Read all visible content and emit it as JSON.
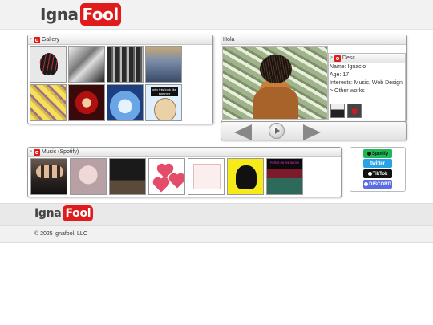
{
  "header": {
    "logo_part1": "Igna",
    "logo_part2": "Fool"
  },
  "gallery": {
    "title": "Gallery",
    "thumb_captions": {
      "t8": "why this look like summer"
    }
  },
  "profile": {
    "title": "Hola",
    "desc_title": "Desc.",
    "name": "Name: Ignacio",
    "age": "Age: 17",
    "interests": "Interests: Music, Web Design",
    "other_works_label": "> Other works"
  },
  "music": {
    "title": "Music (Spotify)",
    "cover_texts": {
      "m7": "PIERCE ON THE BLOCK"
    }
  },
  "social": {
    "spotify": "Spotify",
    "twitter": "twitter",
    "tiktok": "TikTok",
    "discord": "DISCORD"
  },
  "footer": {
    "logo_part1": "Igna",
    "logo_part2": "Fool",
    "copyright": "© 2025 ignafool, LLC"
  },
  "colors": {
    "brand": "#e01b1b",
    "spotify": "#1db954",
    "twitter": "#2aa3e6",
    "tiktok": "#111111",
    "discord": "#5b6ee1"
  },
  "icons": [
    "gallery-icon",
    "music-icon",
    "desc-icon",
    "prev-arrow-icon",
    "play-icon",
    "next-arrow-icon",
    "spotify-icon",
    "twitter-icon",
    "tiktok-icon",
    "discord-icon"
  ]
}
